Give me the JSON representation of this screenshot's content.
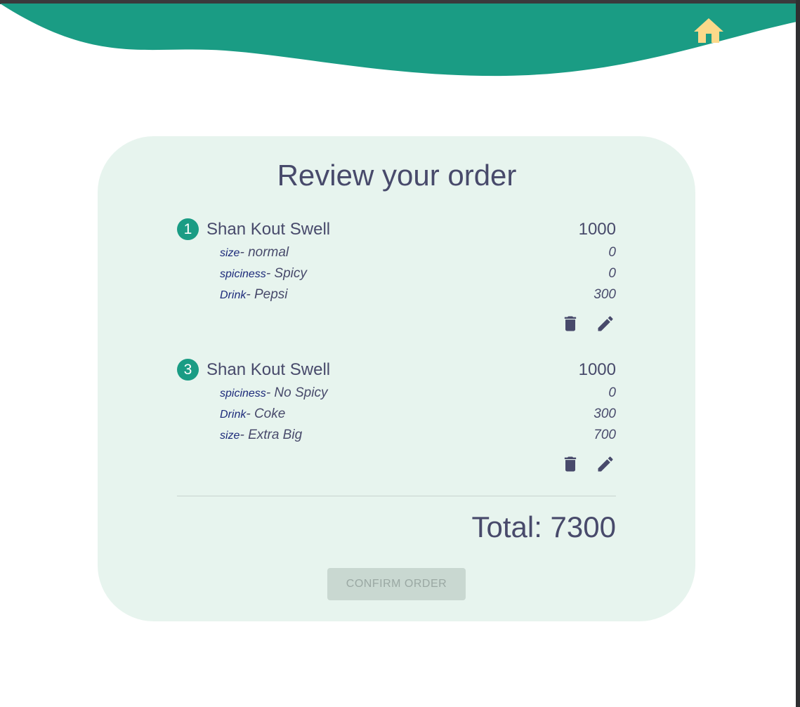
{
  "colors": {
    "header_wave": "#1a9c84",
    "card_background": "#e7f4ee",
    "text": "#484a6b",
    "option_label": "#1c2a7a",
    "home_icon": "#fbd98a",
    "confirm_disabled_bg": "#c9d8d1",
    "confirm_disabled_text": "#9aa8a3"
  },
  "header": {
    "home_icon": "home-icon"
  },
  "page": {
    "title": "Review your order"
  },
  "items": [
    {
      "quantity": "1",
      "name": "Shan Kout Swell",
      "price": "1000",
      "options": [
        {
          "label": "size",
          "value": "normal",
          "price": "0"
        },
        {
          "label": "spiciness",
          "value": "Spicy",
          "price": "0"
        },
        {
          "label": "Drink",
          "value": "Pepsi",
          "price": "300"
        }
      ],
      "actions": {
        "delete_icon": "trash-icon",
        "edit_icon": "pencil-icon"
      }
    },
    {
      "quantity": "3",
      "name": "Shan Kout Swell",
      "price": "1000",
      "options": [
        {
          "label": "spiciness",
          "value": "No Spicy",
          "price": "0"
        },
        {
          "label": "Drink",
          "value": "Coke",
          "price": "300"
        },
        {
          "label": "size",
          "value": "Extra Big",
          "price": "700"
        }
      ],
      "actions": {
        "delete_icon": "trash-icon",
        "edit_icon": "pencil-icon"
      }
    }
  ],
  "summary": {
    "total_text": "Total: 7300"
  },
  "confirm": {
    "label": "CONFIRM ORDER",
    "disabled": true
  }
}
